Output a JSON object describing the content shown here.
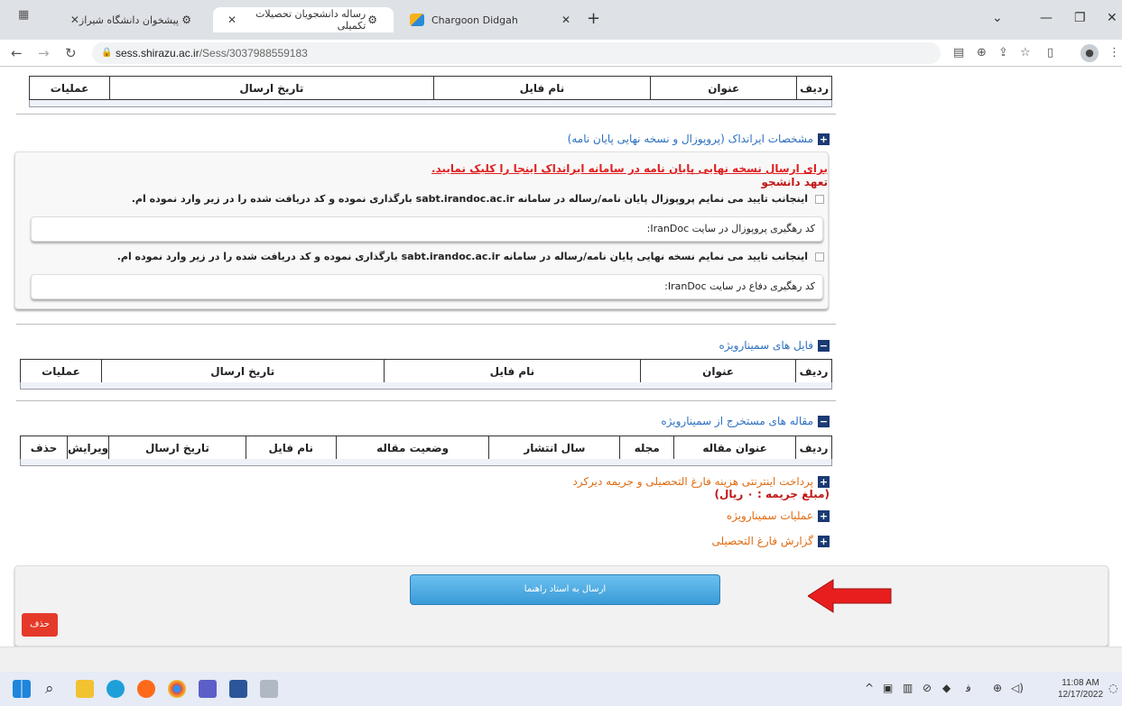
{
  "browser": {
    "tabs": [
      {
        "label": "پیشخوان دانشگاه شیراز"
      },
      {
        "label": "رساله دانشجویان تحصیلات تکمیلی"
      },
      {
        "label": "Chargoon Didgah"
      }
    ],
    "url_host": "sess.shirazu.ac.ir",
    "url_path": "/Sess/3037988559183"
  },
  "table1": {
    "headers": [
      "ردیف",
      "عنوان",
      "نام فایل",
      "تاریخ ارسال",
      "عملیات"
    ]
  },
  "irandoc": {
    "heading": "مشخصات ایرانداک (پروپوزال و نسخه نهایی پایان نامه)",
    "red_link": "برای ارسال نسخه نهایی پایان نامه در سامانه ایرانداک اینجا را کلیک نمایید.",
    "pledge_title": "تعهد دانشجو",
    "check1": "اینجانب تایید می نمایم پروپوزال پایان نامه/رساله در سامانه sabt.irandoc.ac.ir بارگذاری نموده و کد دریافت شده را در زیر وارد نموده ام.",
    "code1": "کد رهگیری پروپوزال در سایت IranDoc:",
    "check2": "اینجانب تایید می نمایم نسخه نهایی پایان نامه/رساله در سامانه sabt.irandoc.ac.ir بارگذاری نموده و کد دریافت شده را در زیر وارد نموده ام.",
    "code2": "کد رهگیری دفاع در سایت IranDoc:"
  },
  "seminar_files": {
    "heading": "فایل های سمینارویژه",
    "headers": [
      "ردیف",
      "عنوان",
      "نام فایل",
      "تاریخ ارسال",
      "عملیات"
    ]
  },
  "seminar_articles": {
    "heading": "مقاله های مستخرج از سمینارویژه",
    "headers": [
      "ردیف",
      "عنوان مقاله",
      "مجله",
      "سال انتشار",
      "وضعیت مقاله",
      "نام فایل",
      "تاریخ ارسال",
      "ویرایش",
      "حذف"
    ]
  },
  "sections": {
    "payment": "پرداخت اینترنتی هزینه فارغ التحصیلی و جریمه دیرکرد",
    "payment_note": "(مبلغ جریمه : ۰ ریال)",
    "seminar_ops": "عملیات سمینارویژه",
    "graduation_report": "گزارش فارغ التحصیلی"
  },
  "actions": {
    "send_label": "ارسال به استاد راهنما",
    "delete_label": "حذف"
  },
  "taskbar": {
    "time": "11:08 AM",
    "date": "12/17/2022",
    "lang": "ﻓ"
  }
}
